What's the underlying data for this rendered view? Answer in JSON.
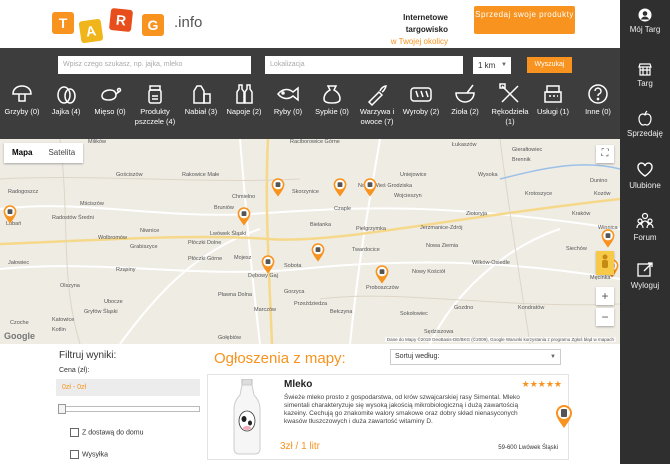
{
  "header": {
    "logo_letters": [
      "T",
      "A",
      "R",
      "G"
    ],
    "logo_suffix": ".info",
    "tagline_line1": "Internetowe",
    "tagline_line2": "targowisko",
    "tagline_line3": "w Twojej okolicy",
    "sell_button": "Sprzedaj swoje produkty"
  },
  "search": {
    "query_placeholder": "Wpisz czego szukasz, np. jajka, mleko",
    "location_placeholder": "Lokalizacja",
    "radius": "1 km",
    "search_button": "Wyszukaj"
  },
  "categories": [
    {
      "label": "Grzyby (0)",
      "icon": "mushroom-icon"
    },
    {
      "label": "Jajka (4)",
      "icon": "egg-icon"
    },
    {
      "label": "Mięso (0)",
      "icon": "meat-icon"
    },
    {
      "label": "Produkty pszczele (4)",
      "icon": "honey-jar-icon"
    },
    {
      "label": "Nabiał (3)",
      "icon": "dairy-icon"
    },
    {
      "label": "Napoje (2)",
      "icon": "bottles-icon"
    },
    {
      "label": "Ryby (0)",
      "icon": "fish-icon"
    },
    {
      "label": "Sypkie (0)",
      "icon": "sack-icon"
    },
    {
      "label": "Warzywa i owoce (7)",
      "icon": "vegetables-icon"
    },
    {
      "label": "Wyroby (2)",
      "icon": "bread-icon"
    },
    {
      "label": "Zioła (2)",
      "icon": "mortar-icon"
    },
    {
      "label": "Rękodzieła (1)",
      "icon": "tools-icon"
    },
    {
      "label": "Usługi (1)",
      "icon": "register-icon"
    },
    {
      "label": "Inne (0)",
      "icon": "question-icon"
    }
  ],
  "sidebar": {
    "items": [
      {
        "label": "Mój Targ",
        "icon": "user-icon"
      },
      {
        "label": "Targ",
        "icon": "market-stall-icon"
      },
      {
        "label": "Sprzedaję",
        "icon": "apple-icon"
      },
      {
        "label": "Ulubione",
        "icon": "heart-icon"
      },
      {
        "label": "Forum",
        "icon": "forum-icon"
      },
      {
        "label": "Wyloguj",
        "icon": "logout-icon"
      }
    ]
  },
  "map": {
    "tab_map": "Mapa",
    "tab_satellite": "Satelita",
    "zoom_in": "+",
    "zoom_out": "−",
    "fullscreen": "⛶",
    "credit": "Dane do Mapy ©2019 GeoBasis-DE/BKG (©2009), Google    Warunki korzystania z programu    Zgłoś błąd w mapach",
    "google": "Google",
    "towns": [
      "Milików",
      "Raciborowice Górne",
      "Łukaszów",
      "Gierałtowiec",
      "Brennik",
      "Gościszów",
      "Rakowice Małe",
      "Uniejowice",
      "Wysoka",
      "Dunino",
      "Radogoszcz",
      "Mściszów",
      "Chmielno",
      "Skorzynice",
      "Nowa Wieś Grodziska",
      "Wojcieszyn",
      "Krotoszyce",
      "Kozów",
      "Radostów Średni",
      "Niwnice",
      "Bruniów",
      "Czaple",
      "Złotoryja",
      "Kraków",
      "Lubań",
      "Wolbromów",
      "Lwówek Śląski",
      "Bielanka",
      "Pielgrzymka",
      "Jerzmanice-Zdrój",
      "Winnica",
      "Grabiszyce",
      "Płóczki Dolne",
      "Twardocice",
      "Nowa Ziemia",
      "Wilków-Osiedle",
      "Siechów",
      "Jałowiec",
      "Płóczki Górne",
      "Mojesz",
      "Sobota",
      "Nowy Kościół",
      "Rząsiny",
      "Dębowy Gaj",
      "Proboszczów",
      "Męcinka",
      "Olszyna",
      "Pławna Dolna",
      "Gorzyca",
      "Ubocze",
      "Przeździedza",
      "Marczów",
      "Sokołowiec",
      "Gozdno",
      "Kondratów",
      "Gryfów Śląski",
      "Bełczyna",
      "Czoche",
      "Kotlin",
      "Gołębiów",
      "Sędziszowa",
      "Katowice"
    ]
  },
  "filter": {
    "title": "Filtruj wyniki:",
    "price_label": "Cena (zł):",
    "price_range": "0zł - 0zł",
    "delivery_label": "Z dostawą do domu",
    "shipping_label": "Wysyłka"
  },
  "listings": {
    "title": "Ogłoszenia z mapy:",
    "sort_label": "Sortuj według:",
    "items": [
      {
        "name": "Mleko",
        "rating": "★★★★★",
        "description": "Świeże mleko prosto z gospodarstwa, od krów szwajcarskiej rasy Simental. Mleko simentali charakteryzuje się wysoką jakością mikrobiologiczną i dużą zawartością kazeiny. Cechują go znakomite walory smakowe oraz dobry skład nienasyconych kwasów tłuszczowych i duża zawartość witaminy D.",
        "price": "3zł / 1 litr",
        "location": "59-600 Lwówek Śląski"
      }
    ]
  },
  "colors": {
    "accent": "#f7931e",
    "dark_bar": "#3d3d3d",
    "sidebar": "#2f2f2f",
    "logo_tiles": [
      "#f7931e",
      "#f0b51b",
      "#e84e1b",
      "#f7931e"
    ]
  }
}
